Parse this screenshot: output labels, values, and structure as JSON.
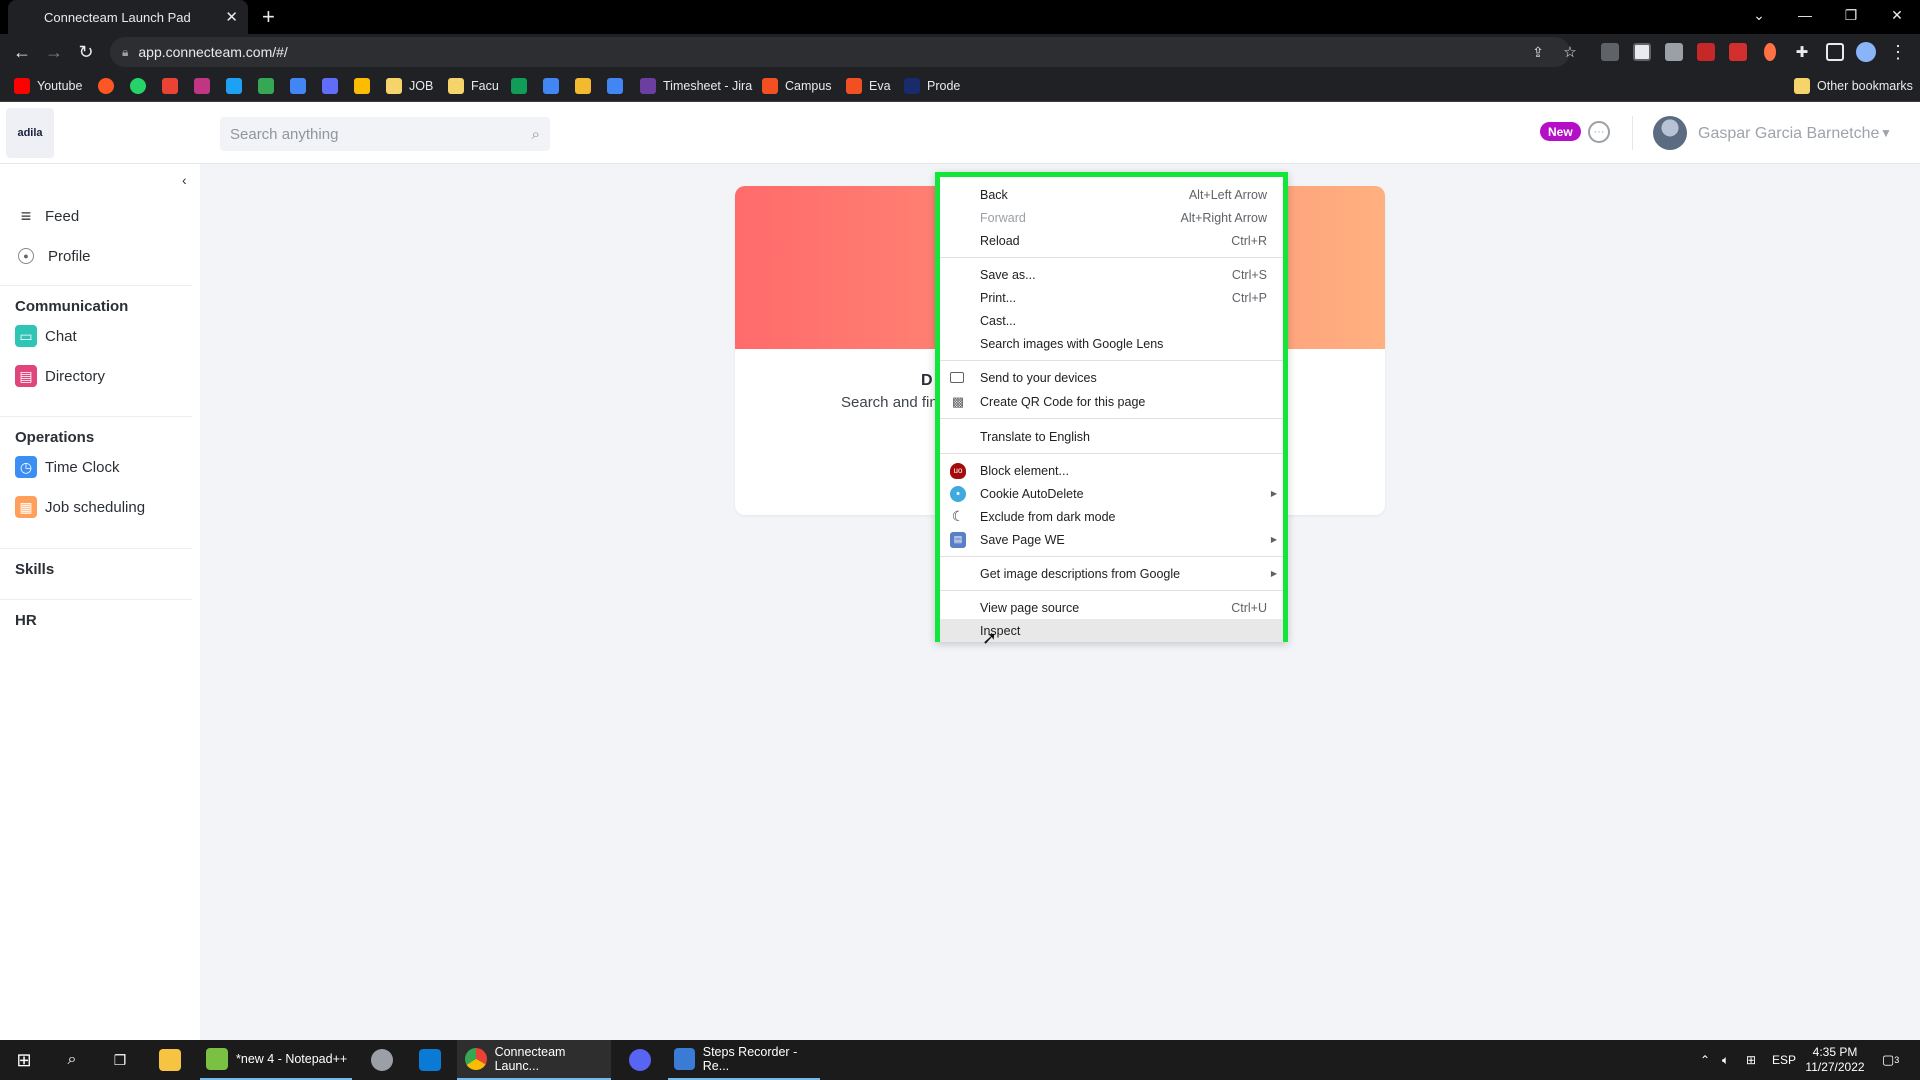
{
  "browser": {
    "tab_title": "Connecteam Launch Pad",
    "tab_close": "✕",
    "new_tab": "+",
    "url": "app.connecteam.com/#/",
    "bookmarks": [
      {
        "label": "Youtube",
        "color": "#ff0000"
      },
      {
        "label": "",
        "color": "#ff5722"
      },
      {
        "label": "",
        "color": "#25d366"
      },
      {
        "label": "",
        "color": "#ea4335"
      },
      {
        "label": "",
        "color": "#c13584"
      },
      {
        "label": "",
        "color": "#1da1f2"
      },
      {
        "label": "",
        "color": "#34a853"
      },
      {
        "label": "",
        "color": "#4285f4"
      },
      {
        "label": "",
        "color": "#5f6dfa"
      },
      {
        "label": "",
        "color": "#fbbc04"
      },
      {
        "label": "JOB",
        "color": "#f6d36b"
      },
      {
        "label": "Facu",
        "color": "#f6d36b"
      },
      {
        "label": "",
        "color": "#0f9d58"
      },
      {
        "label": "",
        "color": "#4285f4"
      },
      {
        "label": "",
        "color": "#f3ba2f"
      },
      {
        "label": "",
        "color": "#4285f4"
      },
      {
        "label": "Timesheet - Jira",
        "color": "#6b3fa0"
      },
      {
        "label": "Campus",
        "color": "#f25022"
      },
      {
        "label": "Eva",
        "color": "#f25022"
      },
      {
        "label": "Prode",
        "color": "#1a2b6d"
      }
    ],
    "other_bookmarks": "Other bookmarks"
  },
  "app": {
    "logo_text": "adila",
    "search_placeholder": "Search anything",
    "new_badge": "New",
    "user_name": "Gaspar Garcia Barnetche"
  },
  "sidebar": {
    "collapse_glyph": "‹",
    "top_items": [
      {
        "label": "Feed",
        "icon": "menu-icon"
      },
      {
        "label": "Profile",
        "icon": "profile-icon"
      }
    ],
    "sections": [
      {
        "heading": "Communication",
        "items": [
          {
            "label": "Chat",
            "icon": "chat-icon",
            "color": "#2ec4b6"
          },
          {
            "label": "Directory",
            "icon": "directory-icon",
            "color": "#e0457b"
          }
        ]
      },
      {
        "heading": "Operations",
        "items": [
          {
            "label": "Time Clock",
            "icon": "time-clock-icon",
            "color": "#3b8ff3"
          },
          {
            "label": "Job scheduling",
            "icon": "job-scheduling-icon",
            "color": "#ff9f5a"
          }
        ]
      }
    ],
    "skills": "Skills",
    "hr": "HR"
  },
  "card": {
    "title": "D",
    "subtitle": "Search and fin"
  },
  "context_menu": {
    "items": [
      {
        "label": "Back",
        "shortcut": "Alt+Left Arrow"
      },
      {
        "label": "Forward",
        "shortcut": "Alt+Right Arrow",
        "disabled": true
      },
      {
        "label": "Reload",
        "shortcut": "Ctrl+R"
      },
      {
        "label": "Save as...",
        "shortcut": "Ctrl+S"
      },
      {
        "label": "Print...",
        "shortcut": "Ctrl+P"
      },
      {
        "label": "Cast...",
        "shortcut": ""
      },
      {
        "label": "Search images with Google Lens",
        "shortcut": ""
      },
      {
        "label": "Send to your devices",
        "shortcut": "",
        "icon": "send-to-devices-icon"
      },
      {
        "label": "Create QR Code for this page",
        "shortcut": "",
        "icon": "qr-code-icon"
      },
      {
        "label": "Translate to English",
        "shortcut": ""
      },
      {
        "label": "Block element...",
        "shortcut": "",
        "icon": "ublock-icon"
      },
      {
        "label": "Cookie AutoDelete",
        "shortcut": "",
        "icon": "cookie-icon",
        "submenu": true
      },
      {
        "label": "Exclude from dark mode",
        "shortcut": "",
        "icon": "dark-mode-icon"
      },
      {
        "label": "Save Page WE",
        "shortcut": "",
        "icon": "save-page-icon",
        "submenu": true
      },
      {
        "label": "Get image descriptions from Google",
        "shortcut": "",
        "submenu": true
      },
      {
        "label": "View page source",
        "shortcut": "Ctrl+U"
      },
      {
        "label": "Inspect",
        "shortcut": "",
        "hover": true
      }
    ],
    "highlight_color": "#13e63a"
  },
  "taskbar": {
    "items": [
      {
        "label": "*new 4 - Notepad++",
        "icon": "notepad-plus-plus-icon",
        "color": "#7ac143"
      },
      {
        "label": "Connecteam Launc...",
        "icon": "chrome-icon",
        "color": "#ea4335",
        "active": true
      },
      {
        "label": "Steps Recorder - Re...",
        "icon": "steps-recorder-icon",
        "color": "#3a7bd5"
      }
    ],
    "language": "ESP",
    "time": "4:35 PM",
    "date": "11/27/2022",
    "notifications": "3"
  }
}
